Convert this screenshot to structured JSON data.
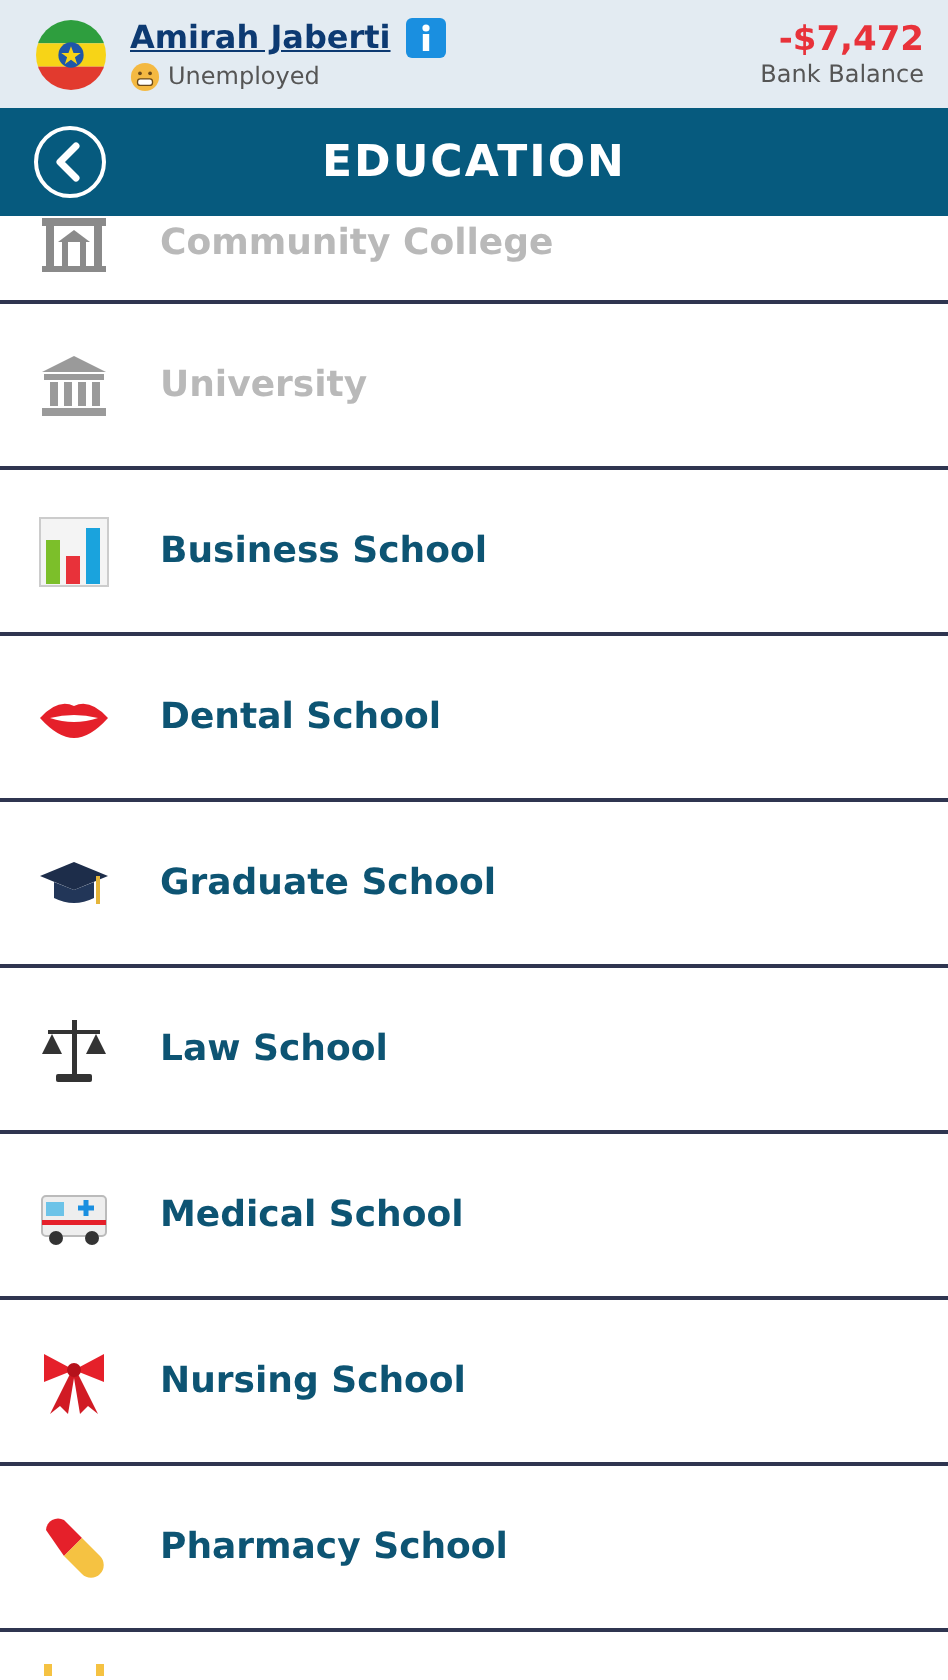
{
  "profile": {
    "name": "Amirah Jaberti",
    "status": "Unemployed",
    "balance": "-$7,472",
    "balance_label": "Bank Balance"
  },
  "title_bar": {
    "title": "EDUCATION"
  },
  "items": [
    {
      "label": "Community College",
      "disabled": true
    },
    {
      "label": "University",
      "disabled": true
    },
    {
      "label": "Business School",
      "disabled": false
    },
    {
      "label": "Dental School",
      "disabled": false
    },
    {
      "label": "Graduate School",
      "disabled": false
    },
    {
      "label": "Law School",
      "disabled": false
    },
    {
      "label": "Medical School",
      "disabled": false
    },
    {
      "label": "Nursing School",
      "disabled": false
    },
    {
      "label": "Pharmacy School",
      "disabled": false
    }
  ]
}
